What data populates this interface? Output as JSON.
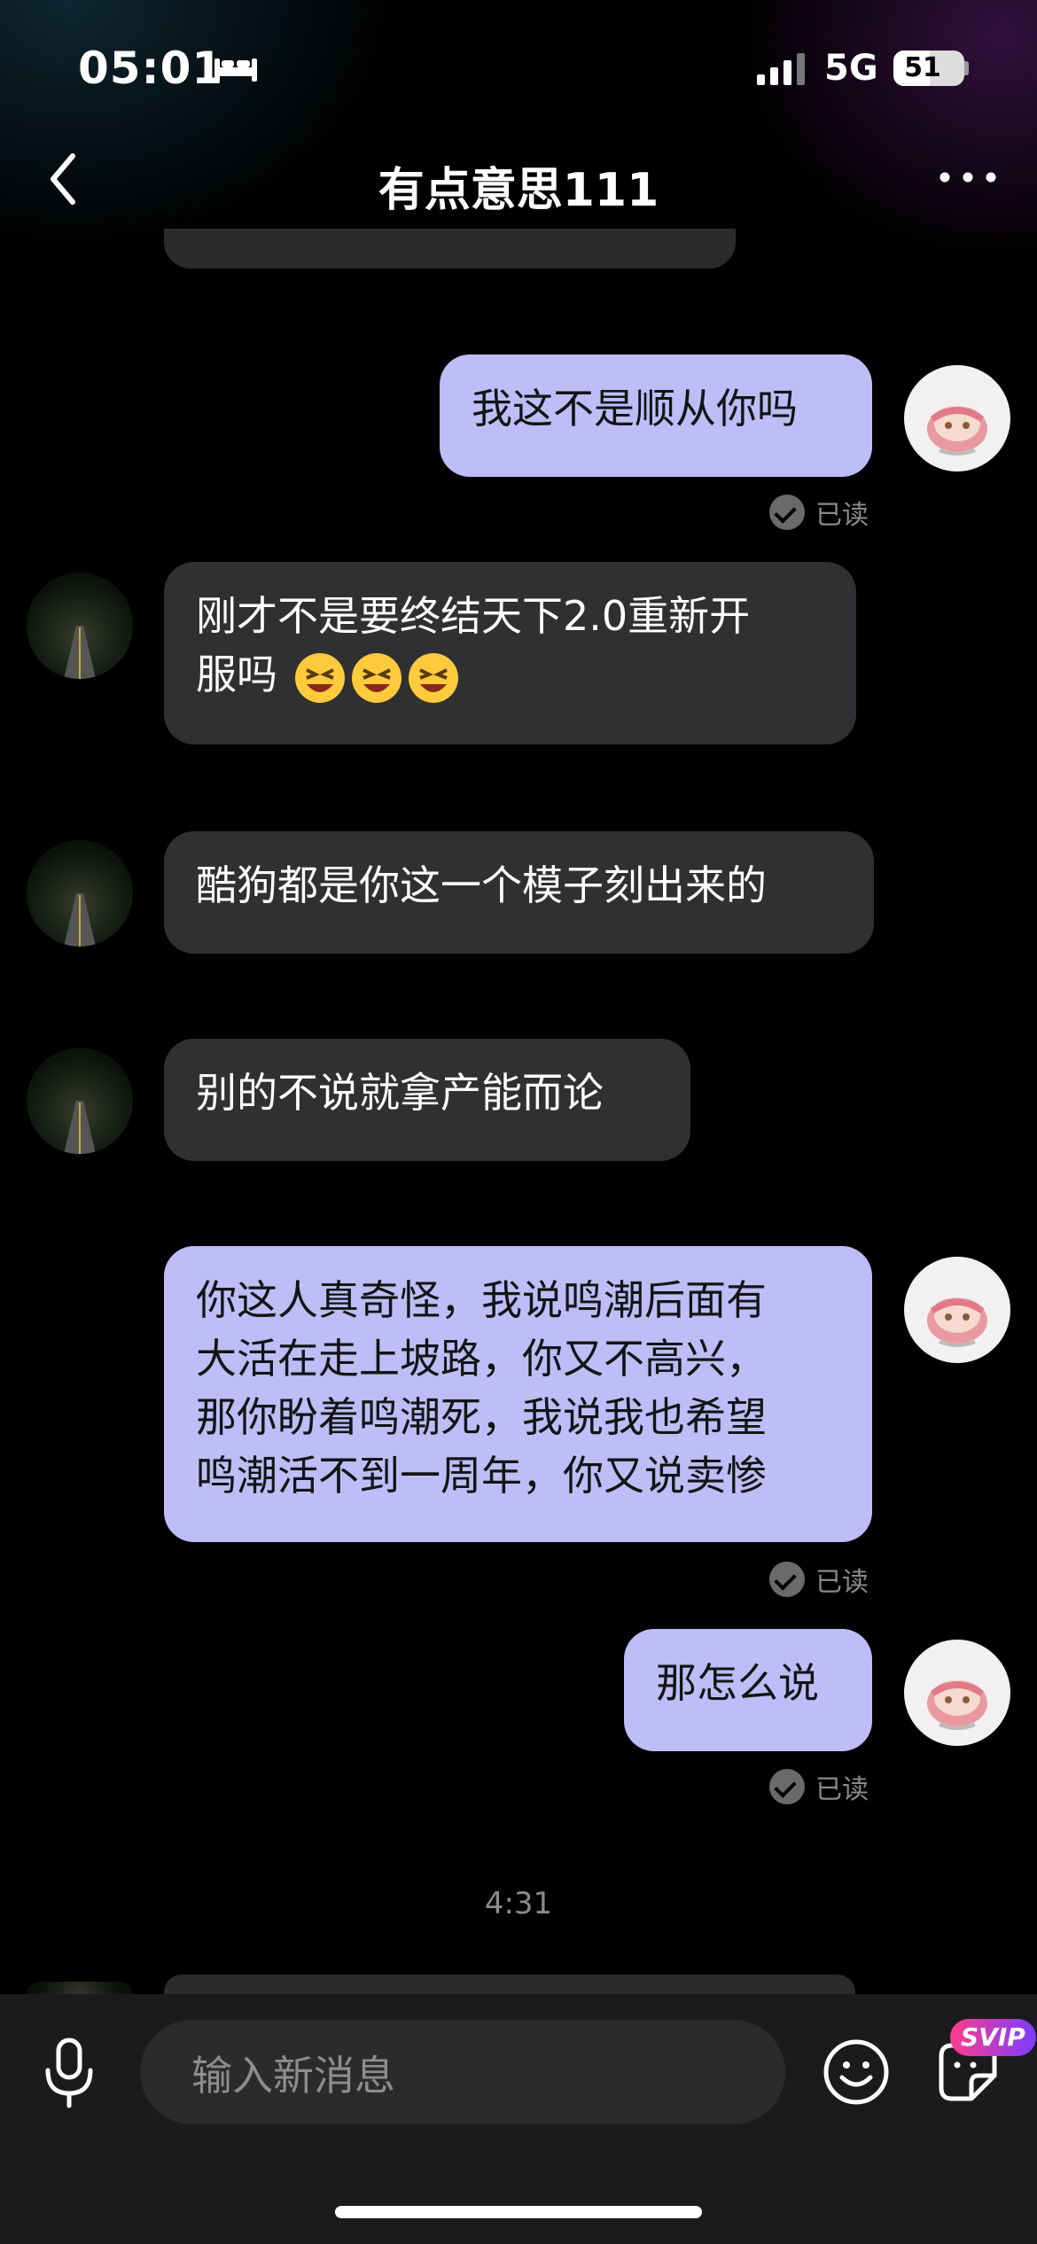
{
  "status_bar": {
    "time": "05:01",
    "network": "5G",
    "battery_level": "51",
    "battery_fraction": 0.51
  },
  "header": {
    "title": "有点意思111"
  },
  "messages": [
    {
      "direction": "out",
      "lines": [
        "我这不是顺从你吗"
      ],
      "status": "已读"
    },
    {
      "direction": "in",
      "lines": [
        "刚才不是要终结天下2.0重新开",
        "服吗"
      ],
      "emoji": [
        "laughing-squint-emoji",
        "laughing-squint-emoji",
        "laughing-squint-emoji"
      ]
    },
    {
      "direction": "in",
      "lines": [
        "酷狗都是你这一个模子刻出来的"
      ]
    },
    {
      "direction": "in",
      "lines": [
        "别的不说就拿产能而论"
      ]
    },
    {
      "direction": "out",
      "lines": [
        "你这人真奇怪，我说鸣潮后面有",
        "大活在走上坡路，你又不高兴，",
        "那你盼着鸣潮死，我说我也希望",
        "鸣潮活不到一周年，你又说卖惨"
      ],
      "status": "已读"
    },
    {
      "direction": "out",
      "lines": [
        "那怎么说"
      ],
      "status": "已读"
    }
  ],
  "time_divider": "4:31",
  "input": {
    "placeholder": "输入新消息"
  },
  "badges": {
    "svip": "SVIP"
  },
  "icons": {
    "back": "back-chevron-icon",
    "more": "more-icon",
    "mic": "microphone-icon",
    "emoji": "smile-icon",
    "sticker": "sticker-icon",
    "read": "read-check-icon"
  },
  "colors": {
    "outgoing_bubble": "#bfbdf8",
    "incoming_bubble": "#303033",
    "background": "#000000",
    "input_bar": "#1b1b1d"
  }
}
